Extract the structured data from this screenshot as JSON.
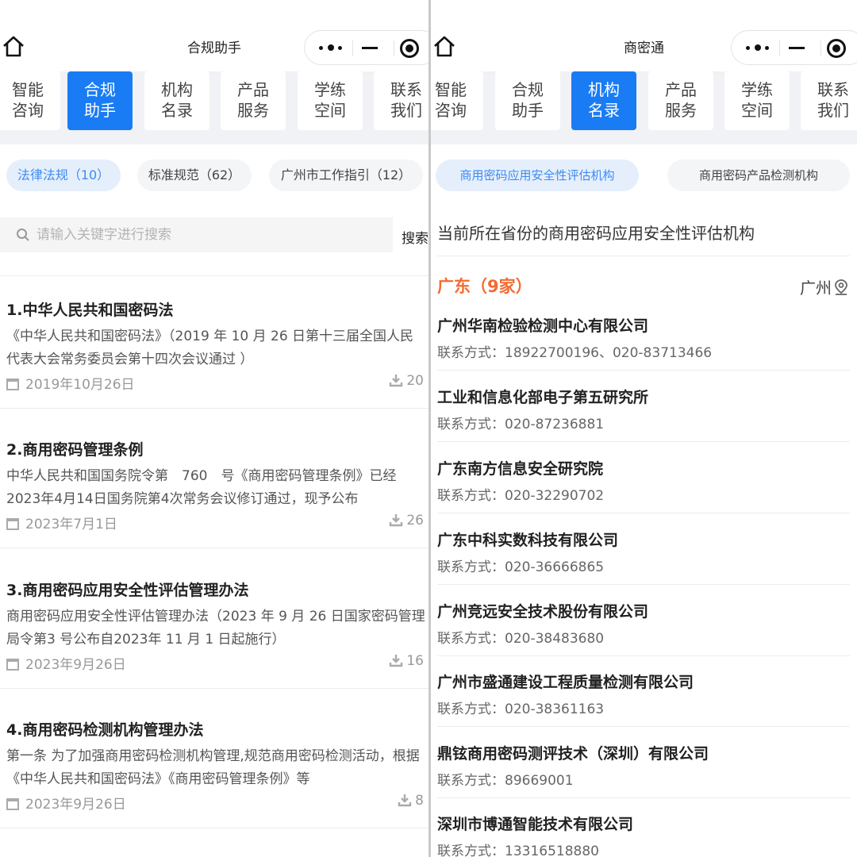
{
  "left": {
    "title": "合规助手",
    "nav": [
      "智能\n咨询",
      "合规\n助手",
      "机构\n名录",
      "产品\n服务",
      "学练\n空间",
      "联系\n我们"
    ],
    "chips": [
      "法律法规（10）",
      "标准规范（62）",
      "广州市工作指引（12）"
    ],
    "search": {
      "placeholder": "请输入关键字进行搜索",
      "button": "搜索"
    },
    "laws": [
      {
        "title": "1.中华人民共和国密码法",
        "desc": "《中华人民共和国密码法》（2019 年 10 月 26 日第十三届全国人民代表大会常务委员会第十四次会议通过 ）",
        "date": "2019年10月26日",
        "downloads": "20"
      },
      {
        "title": "2.商用密码管理条例",
        "desc": "中华人民共和国国务院令第　760　号《商用密码管理条例》已经2023年4月14日国务院第4次常务会议修订通过，现予公布",
        "date": "2023年7月1日",
        "downloads": "26"
      },
      {
        "title": "3.商用密码应用安全性评估管理办法",
        "desc": "商用密码应用安全性评估管理办法（2023 年 9 月 26 日国家密码管理局令第3 号公布自2023年 11 月 1 日起施行）",
        "date": "2023年9月26日",
        "downloads": "16"
      },
      {
        "title": "4.商用密码检测机构管理办法",
        "desc": "第一条 为了加强商用密码检测机构管理,规范商用密码检测活动，根据《中华人民共和国密码法》《商用密码管理条例》等",
        "date": "2023年9月26日",
        "downloads": "8"
      }
    ]
  },
  "right": {
    "title": "商密通",
    "nav": [
      "智能\n咨询",
      "合规\n助手",
      "机构\n名录",
      "产品\n服务",
      "学练\n空间",
      "联系\n我们"
    ],
    "chips": [
      "商用密码应用安全性评估机构",
      "商用密码产品检测机构"
    ],
    "heading": "当前所在省份的商用密码应用安全性评估机构",
    "province": "广东（9家）",
    "city": "广州",
    "orgs": [
      {
        "name": "广州华南检验检测中心有限公司",
        "contact": "联系方式：18922700196、020-83713466"
      },
      {
        "name": "工业和信息化部电子第五研究所",
        "contact": "联系方式：020-87236881"
      },
      {
        "name": "广东南方信息安全研究院",
        "contact": "联系方式：020-32290702"
      },
      {
        "name": "广东中科实数科技有限公司",
        "contact": "联系方式：020-36666865"
      },
      {
        "name": "广州竞远安全技术股份有限公司",
        "contact": "联系方式：020-38483680"
      },
      {
        "name": "广州市盛通建设工程质量检测有限公司",
        "contact": "联系方式：020-38361163"
      },
      {
        "name": "鼎铉商用密码测评技术（深圳）有限公司",
        "contact": "联系方式：89669001"
      },
      {
        "name": "深圳市博通智能技术有限公司",
        "contact": "联系方式：13316518880"
      }
    ]
  },
  "colors": {
    "accent": "#1a7cf4",
    "chip_active_text": "#3d8bf2",
    "province": "#f46b32"
  }
}
